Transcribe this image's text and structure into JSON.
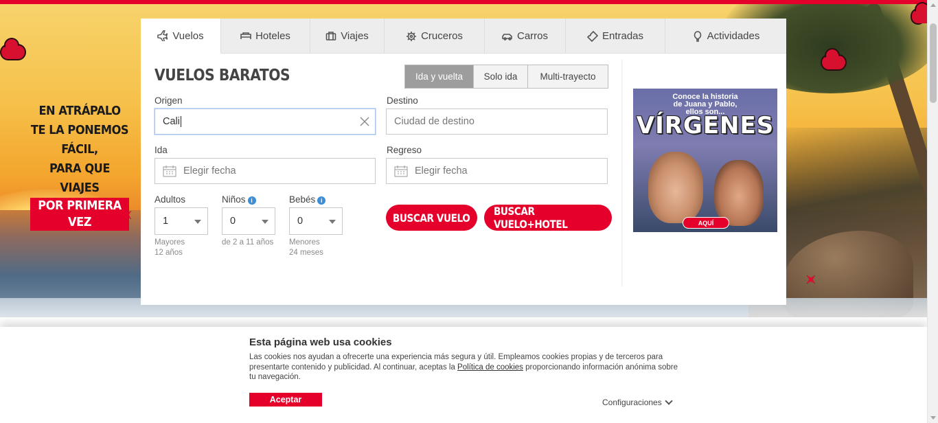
{
  "promo": {
    "lines": [
      "EN ATRÁPALO",
      "TE LA PONEMOS",
      "FÁCIL,",
      "PARA QUE VIAJES"
    ],
    "highlight": "POR PRIMERA VEZ"
  },
  "tabs": [
    {
      "label": "Vuelos",
      "icon": "plane-icon",
      "active": true
    },
    {
      "label": "Hoteles",
      "icon": "bed-icon"
    },
    {
      "label": "Viajes",
      "icon": "suitcase-icon"
    },
    {
      "label": "Cruceros",
      "icon": "ship-wheel-icon"
    },
    {
      "label": "Carros",
      "icon": "car-icon"
    },
    {
      "label": "Entradas",
      "icon": "ticket-icon"
    },
    {
      "label": "Actividades",
      "icon": "balloon-icon"
    }
  ],
  "form": {
    "title": "VUELOS BARATOS",
    "trip_types": [
      "Ida y vuelta",
      "Solo ida",
      "Multi-trayecto"
    ],
    "selected_trip_type": "Ida y vuelta",
    "origin": {
      "label": "Origen",
      "value": "Cali"
    },
    "destination": {
      "label": "Destino",
      "placeholder": "Ciudad de destino"
    },
    "departure": {
      "label": "Ida",
      "placeholder": "Elegir fecha"
    },
    "return": {
      "label": "Regreso",
      "placeholder": "Elegir fecha"
    },
    "adults": {
      "label": "Adultos",
      "value": "1",
      "hint": [
        "Mayores",
        "12 años"
      ]
    },
    "children": {
      "label": "Niños",
      "value": "0",
      "hint": [
        "de 2 a 11 años"
      ]
    },
    "infants": {
      "label": "Bebés",
      "value": "0",
      "hint": [
        "Menores",
        "24 meses"
      ]
    },
    "search_flight": "BUSCAR VUELO",
    "search_flight_hotel": "BUSCAR VUELO+HOTEL"
  },
  "ad": {
    "line1": "Conoce la historia",
    "line2": "de Juana y Pablo,",
    "line3": "ellos son...",
    "headline": "VÍRGENES",
    "cta": "AQUÍ"
  },
  "cookies": {
    "title": "Esta página web usa cookies",
    "text_before": "Las cookies nos ayudan a ofrecerte una experiencia más segura y útil. Empleamos cookies propias y de terceros para presentarte contenido y publicidad. Al continuar, aceptas la ",
    "link": "Política de cookies",
    "text_after": " proporcionando información anónima sobre tu navegación.",
    "accept": "Aceptar",
    "config": "Configuraciones"
  },
  "colors": {
    "brand_red": "#e4002b",
    "active_trip": "#9d9d9d"
  }
}
